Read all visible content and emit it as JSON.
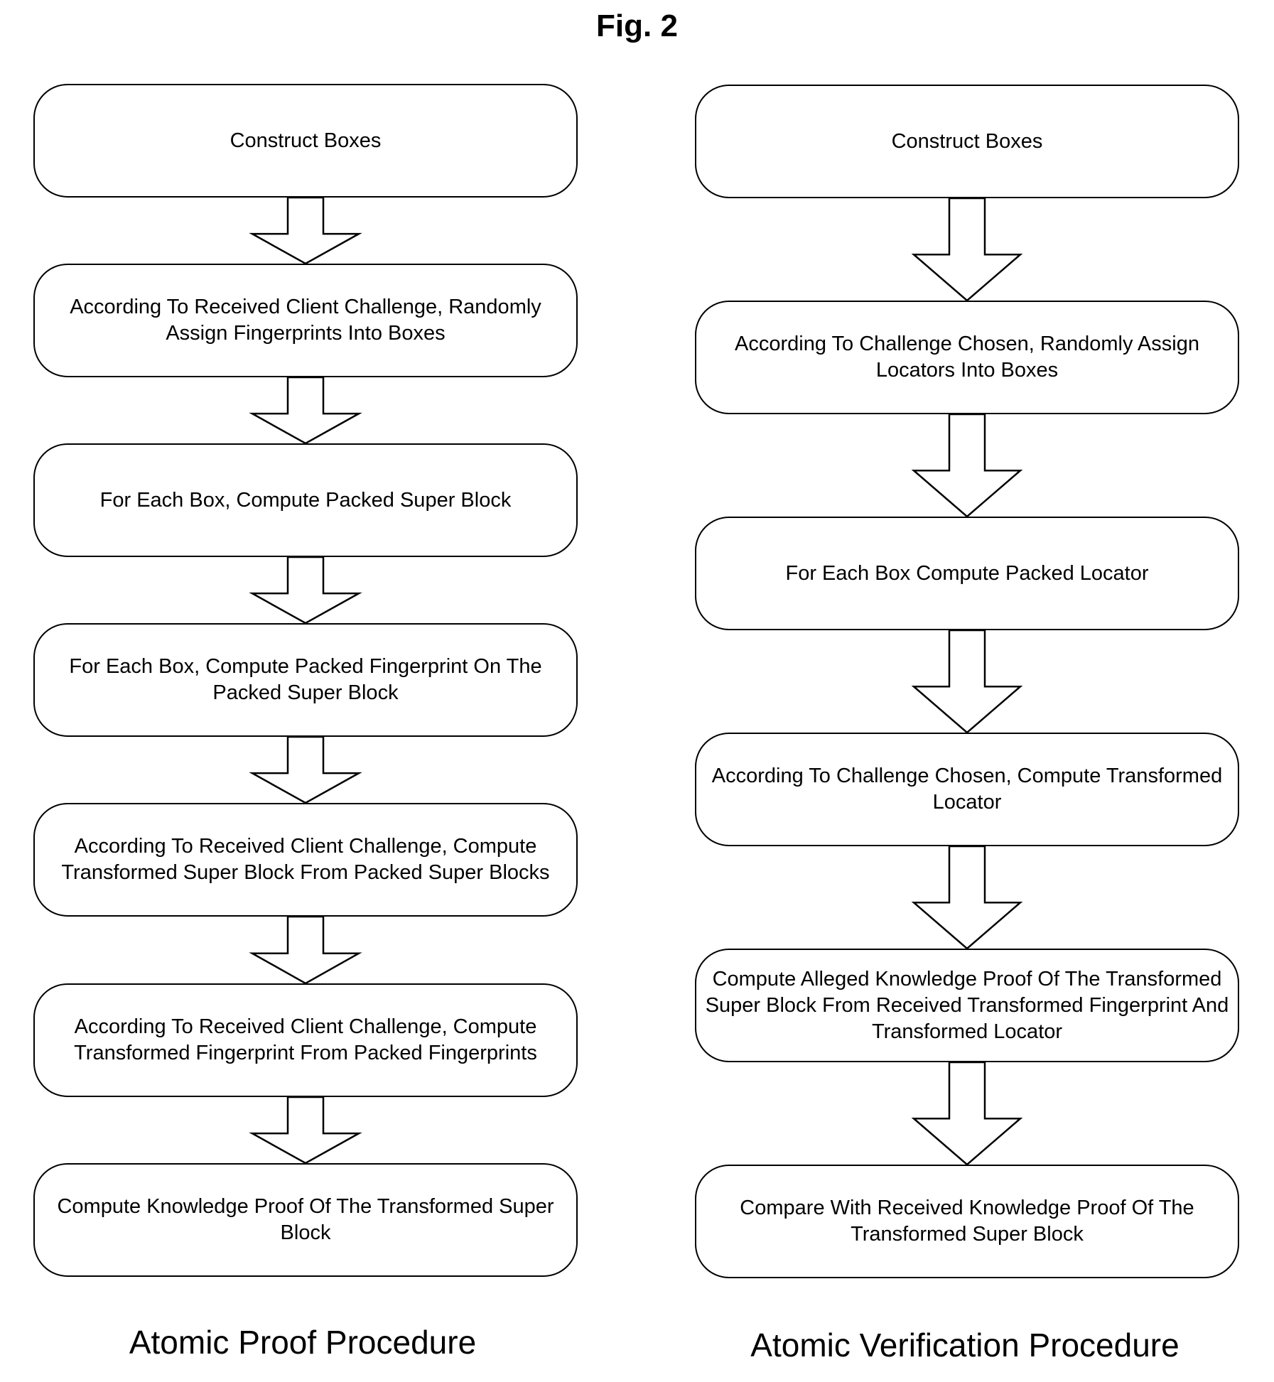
{
  "figure": {
    "title": "Fig. 2",
    "left_column": {
      "label": "Atomic Proof Procedure",
      "steps": [
        "Construct Boxes",
        "According To Received Client Challenge, Randomly Assign Fingerprints Into Boxes",
        "For Each Box, Compute Packed Super Block",
        "For Each Box, Compute Packed Fingerprint On The Packed Super Block",
        "According To Received Client Challenge, Compute Transformed Super Block From Packed Super Blocks",
        "According To Received Client Challenge, Compute Transformed Fingerprint From Packed Fingerprints",
        "Compute Knowledge Proof Of The Transformed Super Block"
      ]
    },
    "right_column": {
      "label": "Atomic Verification Procedure",
      "steps": [
        "Construct Boxes",
        "According To Challenge Chosen, Randomly Assign Locators Into Boxes",
        "For Each Box Compute Packed Locator",
        "According To Challenge Chosen, Compute Transformed Locator",
        "Compute Alleged Knowledge Proof Of The Transformed Super Block From Received Transformed Fingerprint And Transformed Locator",
        "Compare With Received Knowledge Proof Of The Transformed Super Block"
      ]
    }
  }
}
